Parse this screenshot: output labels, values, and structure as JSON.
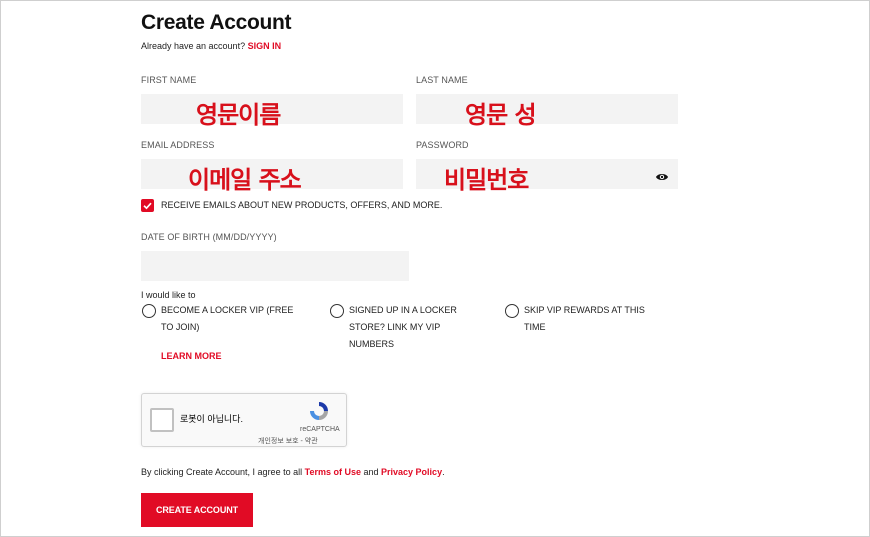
{
  "header": {
    "title": "Create Account",
    "signin_prompt": "Already have an account?",
    "signin_link": "SIGN IN"
  },
  "form": {
    "first_name": {
      "label": "FIRST NAME",
      "overlay": "영문이름"
    },
    "last_name": {
      "label": "LAST NAME",
      "overlay": "영문 성"
    },
    "email": {
      "label": "EMAIL ADDRESS",
      "overlay": "이메일 주소"
    },
    "password": {
      "label": "PASSWORD",
      "overlay": "비밀번호",
      "toggle_icon": "eye-icon"
    },
    "receive_emails": {
      "label": "RECEIVE EMAILS ABOUT NEW PRODUCTS, OFFERS, AND MORE.",
      "checked": true
    },
    "dob": {
      "label": "DATE OF BIRTH (MM/DD/YYYY)",
      "value": ""
    }
  },
  "vip": {
    "prompt": "I would like to",
    "options": [
      {
        "line1": "BECOME A LOCKER VIP (FREE",
        "line2": "TO JOIN)"
      },
      {
        "line1": "SIGNED UP IN A LOCKER",
        "line2": "STORE? LINK MY VIP",
        "line3": "NUMBERS"
      },
      {
        "line1": "SKIP VIP REWARDS AT THIS",
        "line2": "TIME"
      }
    ],
    "learn_more": "LEARN MORE"
  },
  "recaptcha": {
    "label": "로봇이 아닙니다.",
    "brand": "reCAPTCHA",
    "links": "개인정보 보호 - 약관"
  },
  "terms": {
    "prefix": "By clicking Create Account, I agree to all",
    "terms_link": "Terms of Use",
    "and": "and",
    "privacy_link": "Privacy Policy",
    "suffix": "."
  },
  "submit": {
    "label": "CREATE ACCOUNT"
  },
  "colors": {
    "accent": "#e10b25",
    "field_bg": "#f3f3f3",
    "overlay_red": "#d8101b"
  }
}
